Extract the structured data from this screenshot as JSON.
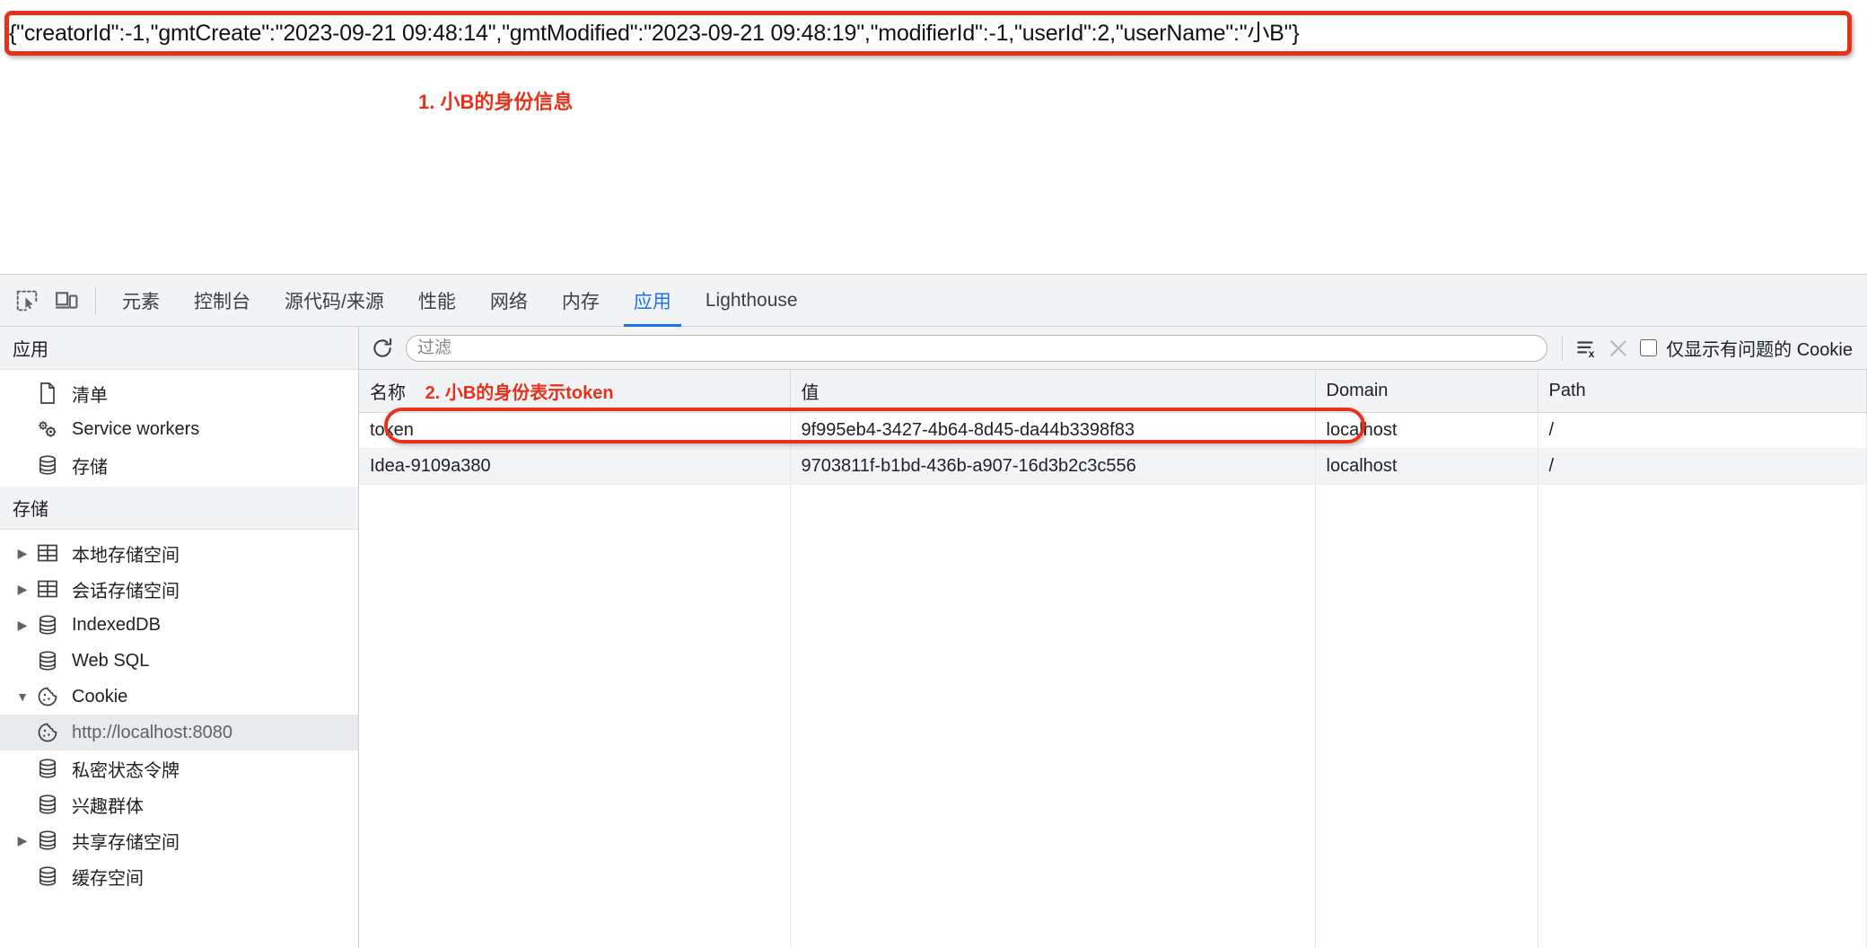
{
  "page": {
    "json_response": "{\"creatorId\":-1,\"gmtCreate\":\"2023-09-21 09:48:14\",\"gmtModified\":\"2023-09-21 09:48:19\",\"modifierId\":-1,\"userId\":2,\"userName\":\"小B\"}",
    "annotation_1": "1. 小B的身份信息",
    "annotation_2": "2. 小B的身份表示token",
    "annotation_color": "#e8311a"
  },
  "devtools": {
    "toolbar_icons": [
      {
        "name": "inspect-element-icon",
        "label": "检查元素"
      },
      {
        "name": "device-toolbar-icon",
        "label": "切换设备工具栏"
      }
    ],
    "tabs": [
      {
        "label": "元素",
        "active": false
      },
      {
        "label": "控制台",
        "active": false
      },
      {
        "label": "源代码/来源",
        "active": false
      },
      {
        "label": "性能",
        "active": false
      },
      {
        "label": "网络",
        "active": false
      },
      {
        "label": "内存",
        "active": false
      },
      {
        "label": "应用",
        "active": true
      },
      {
        "label": "Lighthouse",
        "active": false
      }
    ],
    "active_tab": "应用",
    "accent_color": "#1a73e8"
  },
  "sidebar": {
    "section_application": {
      "title": "应用",
      "items": [
        {
          "label": "清单",
          "icon": "document-icon",
          "twisty": "",
          "selected": false
        },
        {
          "label": "Service workers",
          "icon": "gears-icon",
          "twisty": "",
          "selected": false
        },
        {
          "label": "存储",
          "icon": "database-icon",
          "twisty": "",
          "selected": false
        }
      ]
    },
    "section_storage": {
      "title": "存储",
      "items": [
        {
          "label": "本地存储空间",
          "icon": "table-icon",
          "twisty": "collapsed",
          "selected": false,
          "indent": false
        },
        {
          "label": "会话存储空间",
          "icon": "table-icon",
          "twisty": "collapsed",
          "selected": false,
          "indent": false
        },
        {
          "label": "IndexedDB",
          "icon": "database-icon",
          "twisty": "collapsed",
          "selected": false,
          "indent": false
        },
        {
          "label": "Web SQL",
          "icon": "database-icon",
          "twisty": "",
          "selected": false,
          "indent": false
        },
        {
          "label": "Cookie",
          "icon": "cookie-icon",
          "twisty": "expanded",
          "selected": false,
          "indent": false
        },
        {
          "label": "http://localhost:8080",
          "icon": "cookie-icon",
          "twisty": "",
          "selected": true,
          "indent": true
        },
        {
          "label": "私密状态令牌",
          "icon": "database-icon",
          "twisty": "",
          "selected": false,
          "indent": false
        },
        {
          "label": "兴趣群体",
          "icon": "database-icon",
          "twisty": "",
          "selected": false,
          "indent": false
        },
        {
          "label": "共享存储空间",
          "icon": "database-icon",
          "twisty": "collapsed",
          "selected": false,
          "indent": false
        },
        {
          "label": "缓存空间",
          "icon": "database-icon",
          "twisty": "",
          "selected": false,
          "indent": false
        }
      ]
    }
  },
  "cookie_panel": {
    "toolbar": {
      "refresh_icon": "refresh-icon",
      "filter_placeholder": "过滤",
      "filter_value": "",
      "clear_all_icon": "clear-all-cookies-icon",
      "delete_icon": "delete-selected-cookie-icon",
      "checkbox_label": "仅显示有问题的 Cookie",
      "checkbox_checked": false
    },
    "columns": [
      "名称",
      "值",
      "Domain",
      "Path"
    ],
    "rows": [
      {
        "name": "token",
        "value": "9f995eb4-3427-4b64-8d45-da44b3398f83",
        "domain": "localhost",
        "path": "/",
        "highlighted": true
      },
      {
        "name": "Idea-9109a380",
        "value": "9703811f-b1bd-436b-a907-16d3b2c3c556",
        "domain": "localhost",
        "path": "/",
        "highlighted": false
      }
    ]
  }
}
